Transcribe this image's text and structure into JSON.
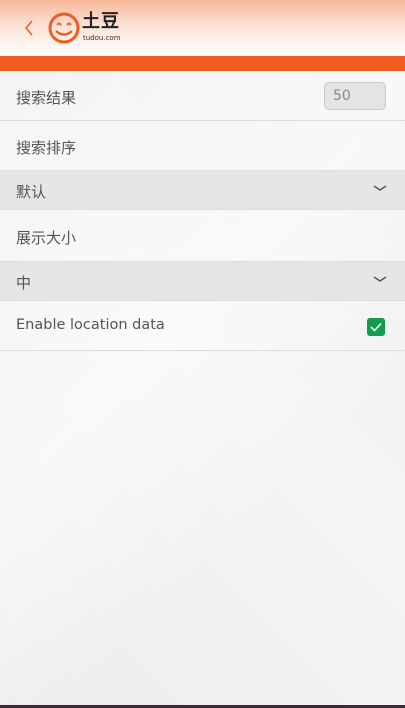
{
  "header": {
    "back_icon": "chevron-left-icon",
    "logo_cn": "土豆",
    "logo_en": "tudou.com"
  },
  "settings": {
    "search_results_label": "搜索结果",
    "search_results_value": "50",
    "search_sort_label": "搜索排序",
    "search_sort_selected": "默认",
    "display_size_label": "展示大小",
    "display_size_selected": "中",
    "location_label": "Enable location data",
    "location_enabled": true
  },
  "colors": {
    "accent": "#f05c22",
    "checkbox": "#139c4a"
  }
}
